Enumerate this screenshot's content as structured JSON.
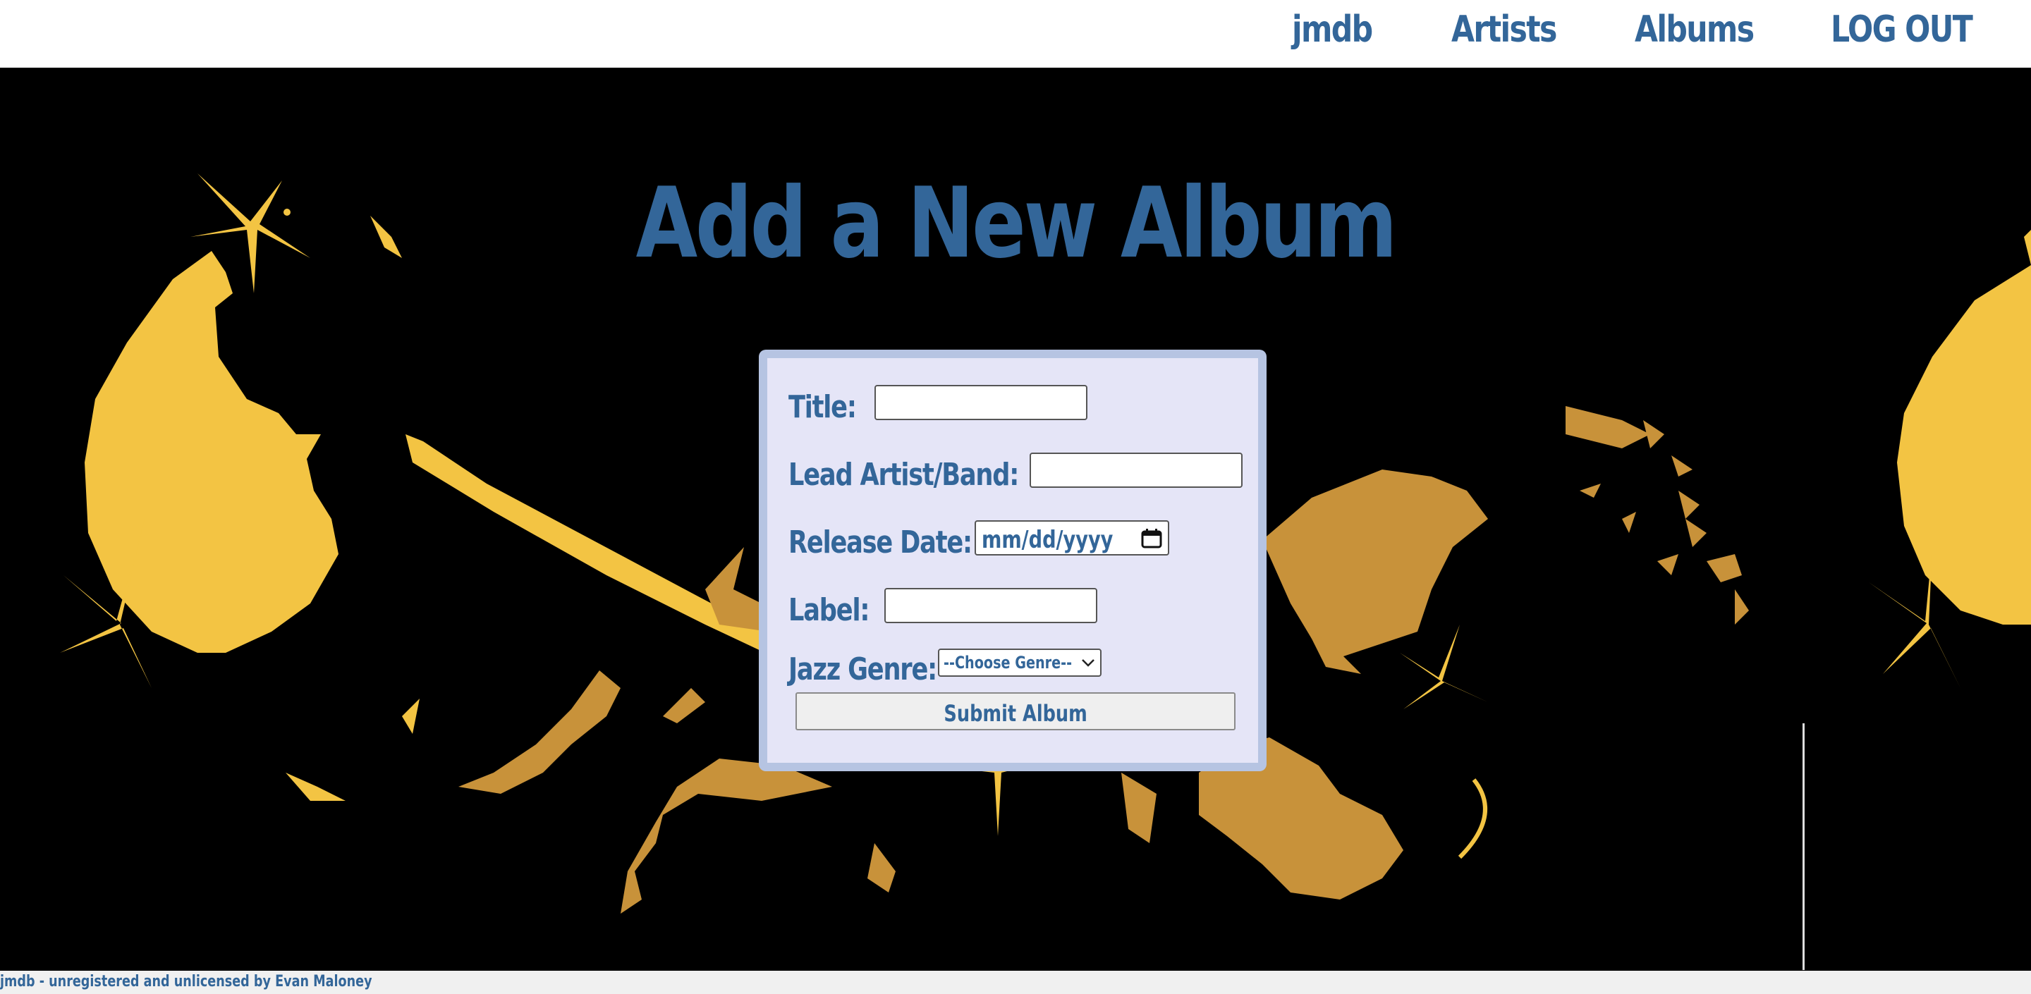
{
  "nav": {
    "home_label": "jmdb",
    "artists_label": "Artists",
    "albums_label": "Albums",
    "logout_label": "LOG OUT"
  },
  "page": {
    "title": "Add a New Album"
  },
  "form": {
    "title_label": "Title:",
    "title_value": "",
    "artist_label": "Lead Artist/Band:",
    "artist_value": "",
    "release_label": "Release Date:",
    "release_placeholder": "mm/dd/yyyy",
    "label_label": "Label:",
    "label_value": "",
    "genre_label": "Jazz Genre:",
    "genre_selected": "--Choose Genre--",
    "submit_label": "Submit Album"
  },
  "footer": {
    "text": "jmdb - unregistered and unlicensed by Evan Maloney"
  },
  "colors": {
    "brand_blue": "#336699",
    "hero_background": "#000000",
    "art_yellow": "#f3c443",
    "art_gold": "#c8923a",
    "panel_background": "#e5e5f7",
    "panel_border": "#b6c4e2"
  },
  "icons": {
    "date_picker": "calendar-icon",
    "select_arrow": "chevron-down-icon"
  }
}
